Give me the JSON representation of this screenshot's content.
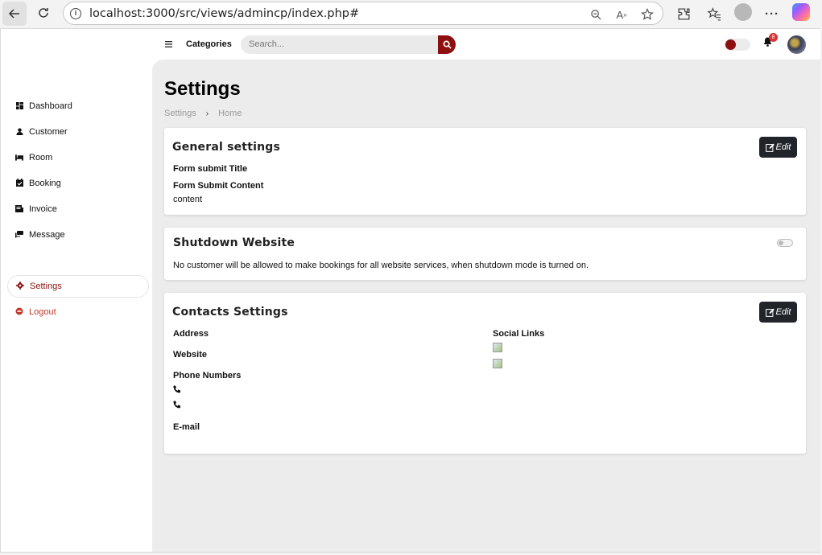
{
  "browser": {
    "url": "localhost:3000/src/views/admincp/index.php#"
  },
  "topbar": {
    "categories_label": "Categories",
    "search_placeholder": "Search...",
    "notification_count": "8"
  },
  "sidebar": {
    "items": [
      {
        "label": "Dashboard",
        "icon": "dashboard-icon"
      },
      {
        "label": "Customer",
        "icon": "user-icon"
      },
      {
        "label": "Room",
        "icon": "bed-icon"
      },
      {
        "label": "Booking",
        "icon": "calendar-check-icon"
      },
      {
        "label": "Invoice",
        "icon": "invoice-icon"
      },
      {
        "label": "Message",
        "icon": "comments-icon"
      }
    ],
    "settings_label": "Settings",
    "logout_label": "Logout"
  },
  "page": {
    "title": "Settings",
    "breadcrumb": [
      "Settings",
      "Home"
    ]
  },
  "general_settings": {
    "title": "General settings",
    "edit_label": "Edit",
    "form_submit_title_label": "Form submit Title",
    "form_submit_content_label": "Form Submit Content",
    "form_submit_content_value": "content"
  },
  "shutdown": {
    "title": "Shutdown Website",
    "description": "No customer will be allowed to make bookings for all website services, when shutdown mode is turned on.",
    "enabled": false
  },
  "contacts": {
    "title": "Contacts Settings",
    "edit_label": "Edit",
    "address_label": "Address",
    "website_label": "Website",
    "phone_label": "Phone Numbers",
    "email_label": "E-mail",
    "social_label": "Social Links"
  },
  "colors": {
    "accent": "#8c1010",
    "dark_button": "#212529",
    "content_bg": "#ececec"
  }
}
